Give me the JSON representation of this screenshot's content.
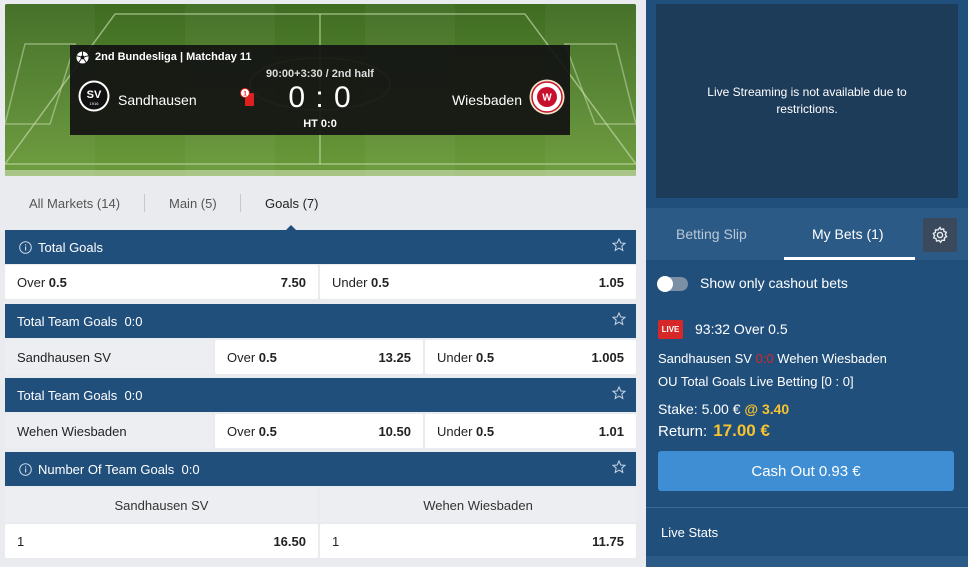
{
  "scoreboard": {
    "league": "2nd Bundesliga | Matchday 11",
    "time": "90:00+3:30 / 2nd half",
    "home_team": "Sandhausen",
    "away_team": "Wiesbaden",
    "score": "0 : 0",
    "halftime": "HT 0:0",
    "red_card_count": "1"
  },
  "tabs": [
    {
      "label": "All Markets (14)"
    },
    {
      "label": "Main (5)"
    },
    {
      "label": "Goals (7)"
    }
  ],
  "markets": {
    "total_goals": {
      "title": "Total Goals",
      "over_label": "Over",
      "over_line": "0.5",
      "over_odds": "7.50",
      "under_label": "Under",
      "under_line": "0.5",
      "under_odds": "1.05"
    },
    "team_goals_home": {
      "title": "Total Team Goals",
      "score": "0:0",
      "team": "Sandhausen SV",
      "over_label": "Over",
      "over_line": "0.5",
      "over_odds": "13.25",
      "under_label": "Under",
      "under_line": "0.5",
      "under_odds": "1.005"
    },
    "team_goals_away": {
      "title": "Total Team Goals",
      "score": "0:0",
      "team": "Wehen Wiesbaden",
      "over_label": "Over",
      "over_line": "0.5",
      "over_odds": "10.50",
      "under_label": "Under",
      "under_line": "0.5",
      "under_odds": "1.01"
    },
    "number_team_goals": {
      "title": "Number Of Team Goals",
      "score": "0:0",
      "home_col": "Sandhausen SV",
      "away_col": "Wehen Wiesbaden",
      "home_sel": "1",
      "home_odds": "16.50",
      "away_sel": "1",
      "away_odds": "11.75"
    }
  },
  "sidebar": {
    "stream_message": "Live Streaming is not available due to restrictions.",
    "tab_slip": "Betting Slip",
    "tab_mybets": "My Bets (1)",
    "cashout_toggle_label": "Show only cashout bets",
    "bet": {
      "live_badge": "LIVE",
      "selection": "93:32 Over 0.5",
      "home": "Sandhausen SV",
      "score": "0:0",
      "away": "Wehen Wiesbaden",
      "market": "OU Total Goals Live Betting [0 : 0]",
      "stake_label": "Stake:",
      "stake": "5.00 €",
      "odds": "@ 3.40",
      "return_label": "Return:",
      "return_amount": "17.00 €",
      "cashout_button": "Cash Out 0.93 €"
    },
    "live_stats": "Live Stats"
  },
  "colors": {
    "header_blue": "#214f7c",
    "accent_yellow": "#f7c32e",
    "cashout_blue": "#3f8ed4",
    "live_red": "#d62828",
    "pitch_green": "#4f7d2c"
  }
}
